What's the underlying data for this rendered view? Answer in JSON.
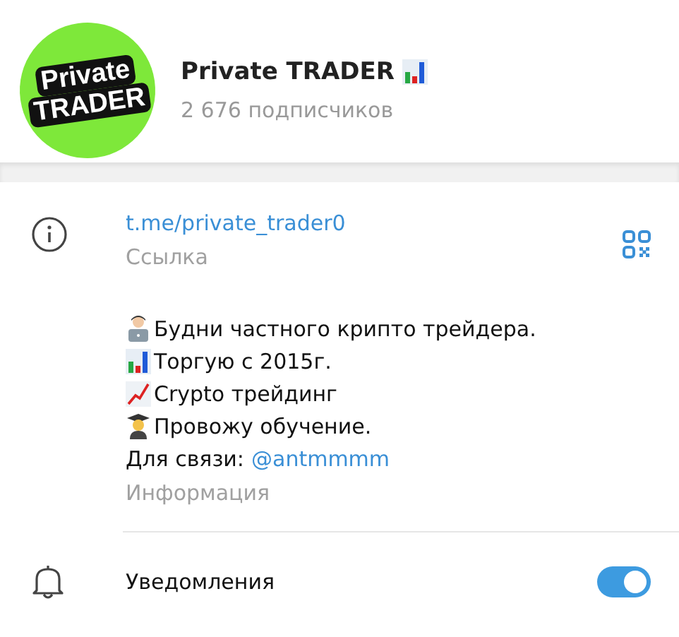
{
  "channel": {
    "avatar_lines": [
      "Private",
      "TRADER"
    ],
    "title": "Private TRADER",
    "subscribers": "2 676 подписчиков"
  },
  "link": {
    "url": "t.me/private_trader0",
    "caption": "Ссылка"
  },
  "description": {
    "lines": [
      {
        "kind": "person-laptop",
        "text": "Будни частного крипто трейдера."
      },
      {
        "kind": "bar-chart",
        "text": "Торгую с 2015г."
      },
      {
        "kind": "trend-chart",
        "text": "Crypto трейдинг"
      },
      {
        "kind": "graduate",
        "text": "Провожу обучение."
      }
    ],
    "contact_label": "Для связи:",
    "contact_link": "@antmmmm",
    "caption": "Информация"
  },
  "notifications": {
    "label": "Уведомления",
    "on": true
  }
}
